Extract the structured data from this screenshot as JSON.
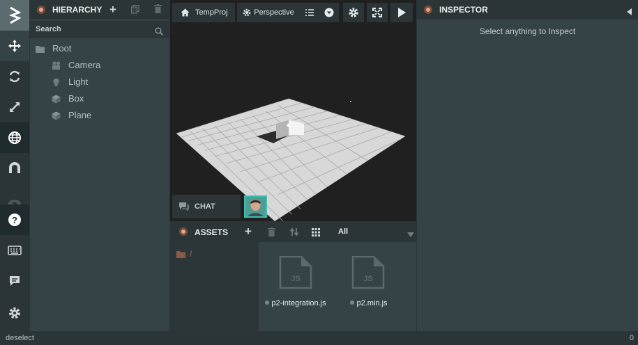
{
  "toolbar": {
    "items": [
      "logo-icon",
      "move-icon",
      "rotate-icon",
      "scale-icon",
      "world-icon",
      "magnet-icon",
      "eye-icon",
      "help-icon",
      "keyboard-icon",
      "chat-bubble-icon",
      "gear-icon"
    ]
  },
  "hierarchy": {
    "title": "HIERARCHY",
    "search_placeholder": "Search",
    "root": "Root",
    "children": [
      "Camera",
      "Light",
      "Box",
      "Plane"
    ]
  },
  "viewport": {
    "project": "TempProj",
    "camera": "Perspective"
  },
  "chat": {
    "label": "CHAT"
  },
  "assets": {
    "title": "ASSETS",
    "filter": "All",
    "path": "/",
    "files": [
      {
        "type": "JS",
        "name": "p2-integration.js"
      },
      {
        "type": "JS",
        "name": "p2.min.js"
      }
    ]
  },
  "inspector": {
    "title": "INSPECTOR",
    "empty_message": "Select anything to Inspect"
  },
  "status": {
    "message": "deselect",
    "count": "0"
  }
}
